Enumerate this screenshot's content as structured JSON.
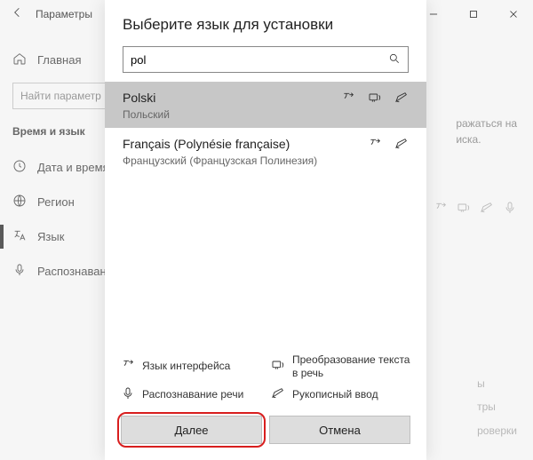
{
  "window": {
    "title": "Параметры",
    "min": "—",
    "max": "☐",
    "close": "✕"
  },
  "sidebar": {
    "home": "Главная",
    "search_placeholder": "Найти параметр",
    "heading": "Время и язык",
    "items": [
      {
        "label": "Дата и время"
      },
      {
        "label": "Регион"
      },
      {
        "label": "Язык"
      },
      {
        "label": "Распознавани"
      }
    ]
  },
  "bg_right": {
    "line1": "ражаться на",
    "line2": "иска."
  },
  "ghost_links": {
    "a": "ы",
    "b": "тры",
    "c": "роверки"
  },
  "dialog": {
    "title": "Выберите язык для установки",
    "search_value": "pol",
    "languages": [
      {
        "native": "Polski",
        "local": "Польский",
        "selected": true,
        "icons": [
          "display",
          "tts",
          "hand"
        ]
      },
      {
        "native": "Français (Polynésie française)",
        "local": "Французский (Французская Полинезия)",
        "selected": false,
        "icons": [
          "display",
          "hand"
        ]
      }
    ],
    "legend": {
      "display": "Язык интерфейса",
      "tts": "Преобразование текста в речь",
      "speech": "Распознавание речи",
      "hand": "Рукописный ввод"
    },
    "next": "Далее",
    "cancel": "Отмена"
  }
}
